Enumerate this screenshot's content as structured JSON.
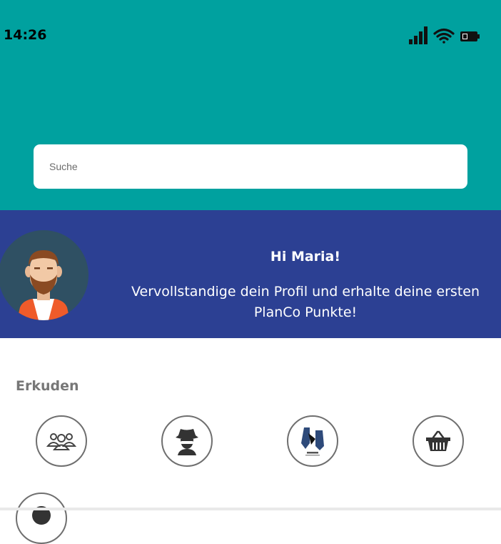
{
  "status_bar": {
    "time": "14:26",
    "icons": [
      "signal-icon",
      "wifi-icon",
      "battery-icon"
    ]
  },
  "search": {
    "placeholder": "Suche"
  },
  "profile_banner": {
    "greeting": "Hi Maria!",
    "message": "Vervollstandige dein Profil und erhalte deine ersten PlanCo Punkte!"
  },
  "explore": {
    "title": "Erkuden",
    "categories": [
      {
        "icon": "group-icon"
      },
      {
        "icon": "spy-icon"
      },
      {
        "icon": "fair-play-hands-icon"
      },
      {
        "icon": "shopping-basket-icon"
      },
      {
        "icon": "user-icon"
      }
    ]
  },
  "colors": {
    "header": "#00a19f",
    "banner": "#2c4093",
    "section_title": "#777777"
  }
}
